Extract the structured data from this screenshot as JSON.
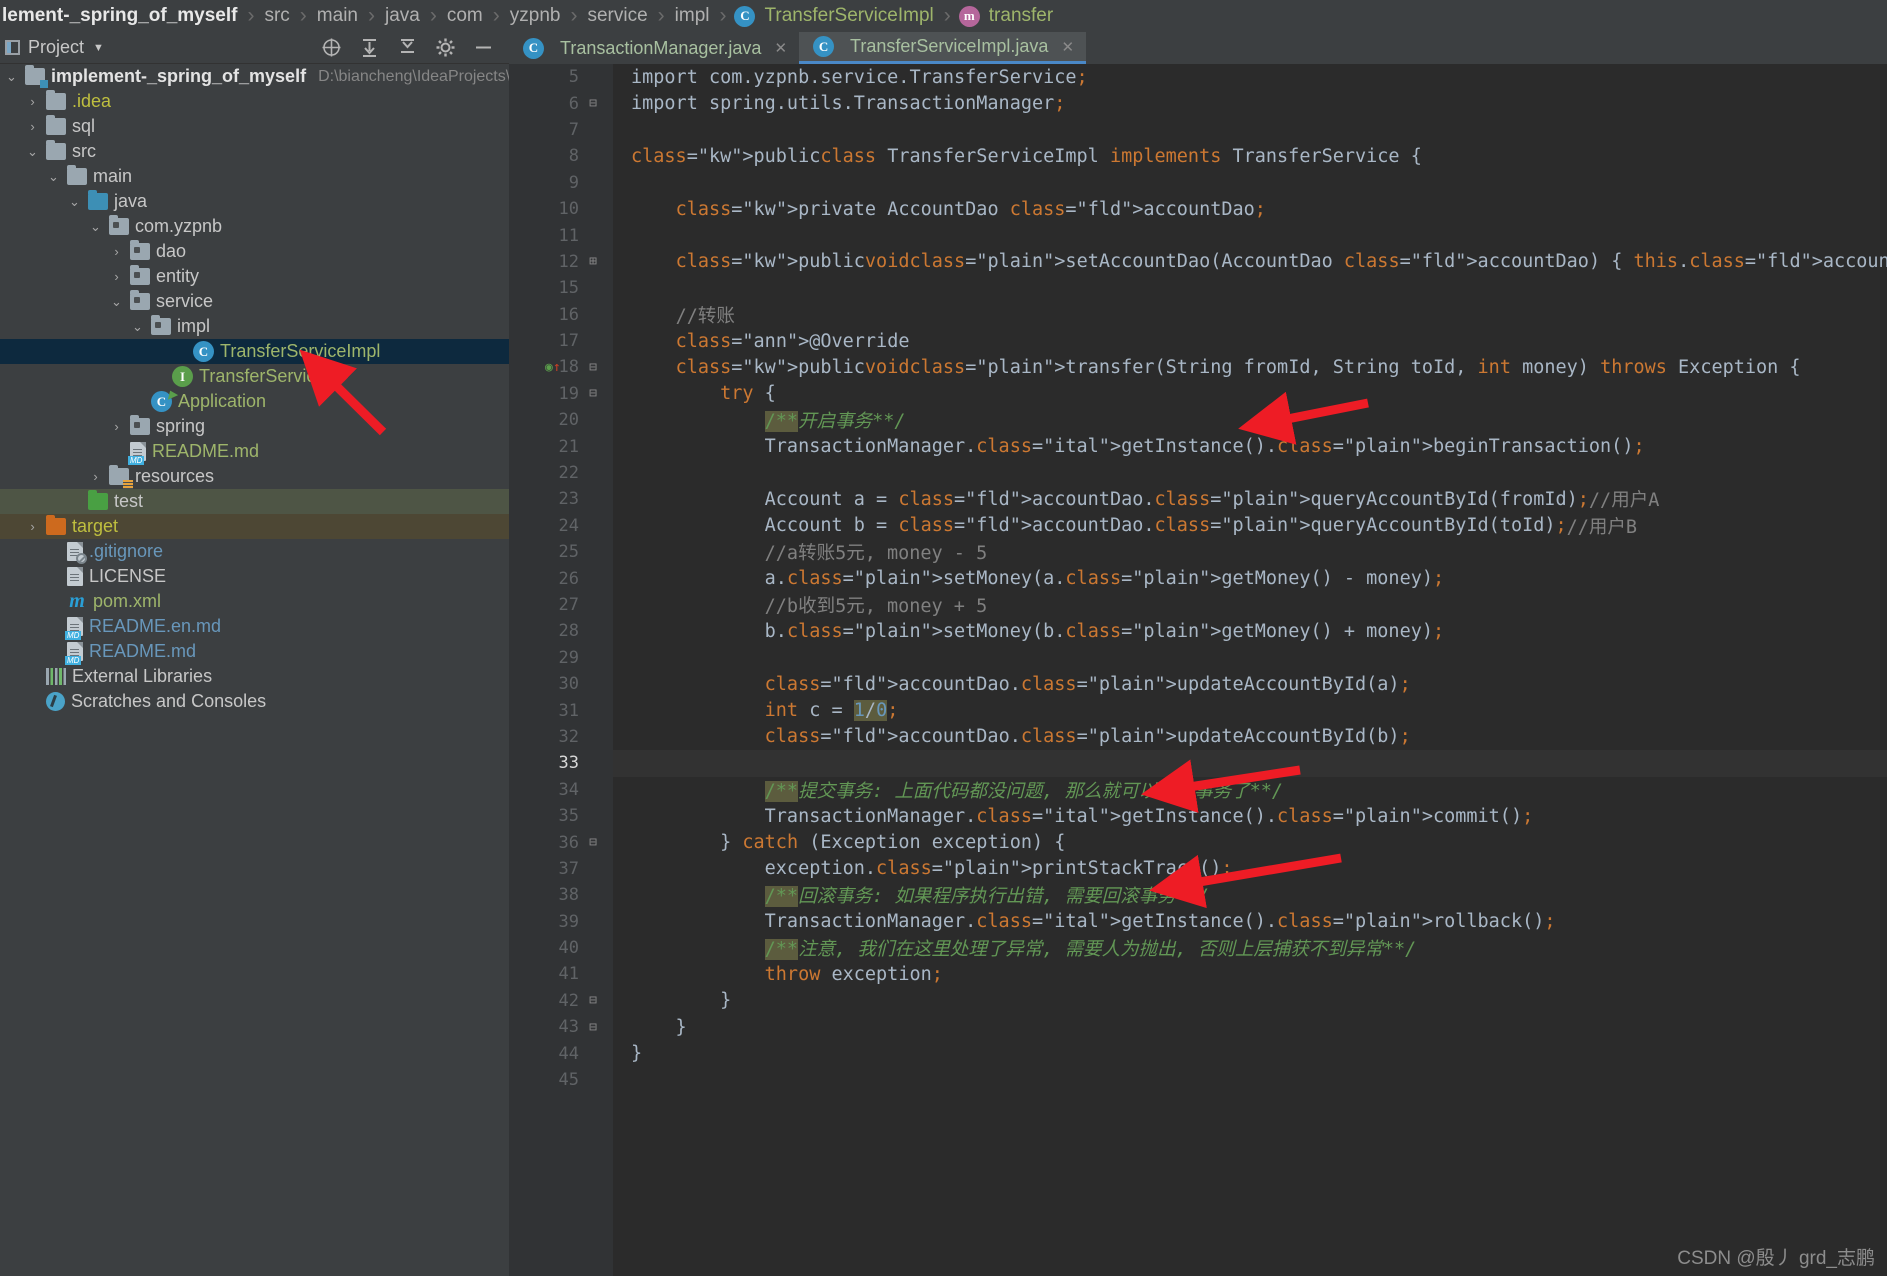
{
  "breadcrumb": {
    "project": "lement-_spring_of_myself",
    "segments": [
      "src",
      "main",
      "java",
      "com",
      "yzpnb",
      "service",
      "impl"
    ],
    "class": "TransferServiceImpl",
    "method": "transfer",
    "class_icon": "C",
    "method_icon": "m"
  },
  "toolwindow": {
    "title": "Project",
    "caret": "▼",
    "actions": [
      {
        "name": "locate-icon",
        "glyph": "⊕"
      },
      {
        "name": "expand-all-icon",
        "glyph": "⇲"
      },
      {
        "name": "collapse-all-icon",
        "glyph": "⇱"
      },
      {
        "name": "settings-gear-icon",
        "glyph": "⚙"
      },
      {
        "name": "hide-icon",
        "glyph": "—"
      }
    ]
  },
  "tree": {
    "root": {
      "label": "implement-_spring_of_myself",
      "path": "D:\\biancheng\\IdeaProjects\\implem"
    },
    "items": [
      {
        "label": ".idea",
        "indent": 1,
        "arrow": "›",
        "icon": "folder",
        "color": "yellow"
      },
      {
        "label": "sql",
        "indent": 1,
        "arrow": "›",
        "icon": "folder",
        "color": "grey"
      },
      {
        "label": "src",
        "indent": 1,
        "arrow": "⌄",
        "icon": "folder",
        "color": "grey"
      },
      {
        "label": "main",
        "indent": 2,
        "arrow": "⌄",
        "icon": "folder",
        "color": "grey"
      },
      {
        "label": "java",
        "indent": 3,
        "arrow": "⌄",
        "icon": "folder-blue",
        "color": "grey"
      },
      {
        "label": "com.yzpnb",
        "indent": 4,
        "arrow": "⌄",
        "icon": "package",
        "color": "grey"
      },
      {
        "label": "dao",
        "indent": 5,
        "arrow": "›",
        "icon": "package",
        "color": "grey"
      },
      {
        "label": "entity",
        "indent": 5,
        "arrow": "›",
        "icon": "package",
        "color": "grey"
      },
      {
        "label": "service",
        "indent": 5,
        "arrow": "⌄",
        "icon": "package",
        "color": "grey"
      },
      {
        "label": "impl",
        "indent": 6,
        "arrow": "⌄",
        "icon": "package",
        "color": "grey"
      },
      {
        "label": "TransferServiceImpl",
        "indent": 8,
        "arrow": "",
        "icon": "class",
        "color": "green",
        "selected": true
      },
      {
        "label": "TransferService",
        "indent": 7,
        "arrow": "",
        "icon": "interface",
        "color": "green"
      },
      {
        "label": "Application",
        "indent": 6,
        "arrow": "",
        "icon": "class-runnable",
        "color": "green"
      },
      {
        "label": "spring",
        "indent": 5,
        "arrow": "›",
        "icon": "package",
        "color": "grey"
      },
      {
        "label": "README.md",
        "indent": 5,
        "arrow": "",
        "icon": "markdown",
        "color": "green"
      },
      {
        "label": "resources",
        "indent": 4,
        "arrow": "›",
        "icon": "folder-resources",
        "color": "grey"
      },
      {
        "label": "test",
        "indent": 3,
        "arrow": "",
        "icon": "folder-green",
        "color": "grey",
        "highlight": "test"
      },
      {
        "label": "target",
        "indent": 1,
        "arrow": "›",
        "icon": "folder-orange",
        "color": "yellow",
        "highlight": "target"
      },
      {
        "label": ".gitignore",
        "indent": 2,
        "arrow": "",
        "icon": "gitignore",
        "color": "blue"
      },
      {
        "label": "LICENSE",
        "indent": 2,
        "arrow": "",
        "icon": "file",
        "color": "grey"
      },
      {
        "label": "pom.xml",
        "indent": 2,
        "arrow": "",
        "icon": "maven",
        "color": "green"
      },
      {
        "label": "README.en.md",
        "indent": 2,
        "arrow": "",
        "icon": "markdown",
        "color": "blue"
      },
      {
        "label": "README.md",
        "indent": 2,
        "arrow": "",
        "icon": "markdown",
        "color": "blue"
      },
      {
        "label": "External Libraries",
        "indent": 1,
        "arrow": "",
        "icon": "libraries",
        "color": "grey"
      },
      {
        "label": "Scratches and Consoles",
        "indent": 1,
        "arrow": "",
        "icon": "scratches",
        "color": "grey"
      }
    ]
  },
  "tabs": [
    {
      "label": "TransactionManager.java",
      "icon": "C",
      "active": false,
      "close": "✕"
    },
    {
      "label": "TransferServiceImpl.java",
      "icon": "C",
      "active": true,
      "close": "✕"
    }
  ],
  "editor": {
    "lines": [
      {
        "num": "5",
        "text": "import com.yzpnb.service.TransferService;",
        "partial": true
      },
      {
        "num": "6",
        "text": "import spring.utils.TransactionManager;",
        "fold": "⊟"
      },
      {
        "num": "7",
        "text": ""
      },
      {
        "num": "8",
        "text": "public class TransferServiceImpl implements TransferService {"
      },
      {
        "num": "9",
        "text": ""
      },
      {
        "num": "10",
        "text": "    private AccountDao accountDao;"
      },
      {
        "num": "11",
        "text": ""
      },
      {
        "num": "12",
        "text": "    public void setAccountDao(AccountDao accountDao) { this.accountDao = accountDao; }",
        "fold": "⊞"
      },
      {
        "num": "15",
        "text": ""
      },
      {
        "num": "16",
        "text": "    //转账"
      },
      {
        "num": "17",
        "text": "    @Override"
      },
      {
        "num": "18",
        "text": "    public void transfer(String fromId, String toId, int money) throws Exception {",
        "fold": "⊟",
        "mark": "override"
      },
      {
        "num": "19",
        "text": "        try {",
        "fold": "⊟"
      },
      {
        "num": "20",
        "text": "            /**开启事务**/"
      },
      {
        "num": "21",
        "text": "            TransactionManager.getInstance().beginTransaction();"
      },
      {
        "num": "22",
        "text": ""
      },
      {
        "num": "23",
        "text": "            Account a = accountDao.queryAccountById(fromId);//用户A"
      },
      {
        "num": "24",
        "text": "            Account b = accountDao.queryAccountById(toId);//用户B"
      },
      {
        "num": "25",
        "text": "            //a转账5元, money - 5"
      },
      {
        "num": "26",
        "text": "            a.setMoney(a.getMoney() - money);"
      },
      {
        "num": "27",
        "text": "            //b收到5元, money + 5"
      },
      {
        "num": "28",
        "text": "            b.setMoney(b.getMoney() + money);"
      },
      {
        "num": "29",
        "text": ""
      },
      {
        "num": "30",
        "text": "            accountDao.updateAccountById(a);"
      },
      {
        "num": "31",
        "text": "            int c = 1/0;"
      },
      {
        "num": "32",
        "text": "            accountDao.updateAccountById(b);"
      },
      {
        "num": "33",
        "text": "",
        "cursor": true
      },
      {
        "num": "34",
        "text": "            /**提交事务: 上面代码都没问题, 那么就可以提交事务了**/"
      },
      {
        "num": "35",
        "text": "            TransactionManager.getInstance().commit();"
      },
      {
        "num": "36",
        "text": "        } catch (Exception exception) {",
        "fold": "⊟"
      },
      {
        "num": "37",
        "text": "            exception.printStackTrace();"
      },
      {
        "num": "38",
        "text": "            /**回滚事务: 如果程序执行出错, 需要回滚事务**/"
      },
      {
        "num": "39",
        "text": "            TransactionManager.getInstance().rollback();"
      },
      {
        "num": "40",
        "text": "            /**注意, 我们在这里处理了异常, 需要人为抛出, 否则上层捕获不到异常**/"
      },
      {
        "num": "41",
        "text": "            throw exception;"
      },
      {
        "num": "42",
        "text": "        }",
        "fold": "⊟"
      },
      {
        "num": "43",
        "text": "    }",
        "fold": "⊟"
      },
      {
        "num": "44",
        "text": "}"
      },
      {
        "num": "45",
        "text": ""
      }
    ]
  },
  "watermark": "CSDN @殷丿 grd_志鹏",
  "colors": {
    "editor_bg": "#2b2b2b",
    "panel_bg": "#3c3f41",
    "gutter_bg": "#313335",
    "selection": "#0d293e",
    "accent_blue": "#4a88c7",
    "arrow_red": "#ee1c25",
    "keyword": "#cc7832",
    "field": "#9876aa",
    "method": "#ffc66d",
    "comment": "#808080",
    "javadoc": "#629755",
    "annotation": "#bbb529",
    "number": "#6897bb"
  }
}
